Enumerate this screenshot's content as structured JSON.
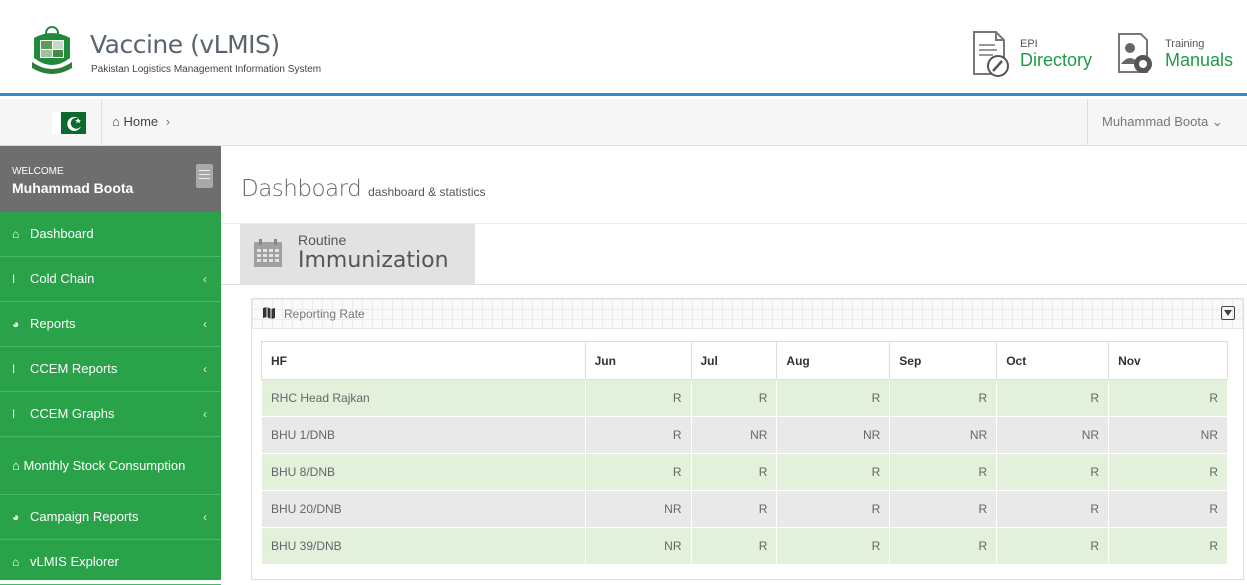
{
  "header": {
    "title": "Vaccine (vLMIS)",
    "subtitle": "Pakistan Logistics Management Information System",
    "links": [
      {
        "small": "EPI",
        "big": "Directory",
        "icon": "directory-icon"
      },
      {
        "small": "Training",
        "big": "Manuals",
        "icon": "manuals-icon"
      }
    ]
  },
  "topbar": {
    "breadcrumb_home": "Home",
    "breadcrumb_chevron": "›",
    "user_name": "Muhammad Boota",
    "user_chevron": "⌄"
  },
  "sidebar": {
    "welcome_label": "WELCOME",
    "welcome_user": "Muhammad Boota",
    "items": [
      {
        "label": "Dashboard",
        "icon": "home-icon",
        "has_arrow": false
      },
      {
        "label": "Cold Chain",
        "icon": "thermometer-icon",
        "has_arrow": true
      },
      {
        "label": "Reports",
        "icon": "pie-chart-icon",
        "has_arrow": true
      },
      {
        "label": "CCEM Reports",
        "icon": "thermometer-icon",
        "has_arrow": true
      },
      {
        "label": "CCEM Graphs",
        "icon": "thermometer-icon",
        "has_arrow": true
      },
      {
        "label": "Monthly Stock Consumption",
        "icon": "home-icon",
        "has_arrow": false
      },
      {
        "label": "Campaign Reports",
        "icon": "pie-chart-icon",
        "has_arrow": true
      },
      {
        "label": "vLMIS Explorer",
        "icon": "home-icon",
        "has_arrow": false
      }
    ],
    "arrow_glyph": "‹"
  },
  "content": {
    "page_title": "Dashboard",
    "page_subtitle": "dashboard & statistics",
    "tab_line1": "Routine",
    "tab_line2": "Immunization",
    "portlet_title": "Reporting Rate",
    "table": {
      "headers": [
        "HF",
        "Jun",
        "Jul",
        "Aug",
        "Sep",
        "Oct",
        "Nov"
      ],
      "rows": [
        [
          "RHC Head Rajkan",
          "R",
          "R",
          "R",
          "R",
          "R",
          "R"
        ],
        [
          "BHU 1/DNB",
          "R",
          "NR",
          "NR",
          "NR",
          "NR",
          "NR"
        ],
        [
          "BHU 8/DNB",
          "R",
          "R",
          "R",
          "R",
          "R",
          "R"
        ],
        [
          "BHU 20/DNB",
          "NR",
          "R",
          "R",
          "R",
          "R",
          "R"
        ],
        [
          "BHU 39/DNB",
          "NR",
          "R",
          "R",
          "R",
          "R",
          "R"
        ]
      ]
    }
  },
  "colors": {
    "accent_blue": "#2a8cd6",
    "sidebar_green": "#2aa24a",
    "brand_green": "#1f9a46"
  }
}
